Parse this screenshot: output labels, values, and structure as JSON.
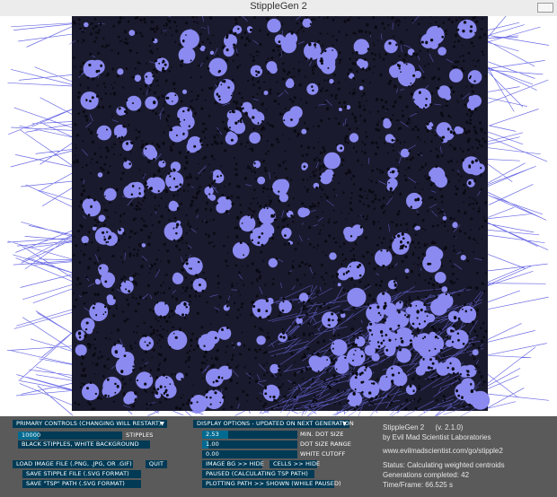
{
  "window": {
    "title": "StippleGen 2"
  },
  "primary": {
    "dropdown_label": "PRIMARY CONTROLS (CHANGING WILL RESTART)",
    "stipples_value": "10000",
    "stipples_fraction": 0.2,
    "stipples_label": "STIPPLES",
    "bg_button": "BLACK STIPPLES, WHITE BACKGROUND",
    "load_button": "LOAD IMAGE FILE (.PNG, .JPG, OR .GIF)",
    "quit_button": "QUIT",
    "save_svg_button": "SAVE STIPPLE FILE (.SVG FORMAT)",
    "save_tsp_button": "SAVE \"TSP\" PATH (.SVG FORMAT)"
  },
  "display": {
    "dropdown_label": "DISPLAY OPTIONS - UPDATED ON NEXT GENERATION",
    "min_dot_value": "2.53",
    "min_dot_fraction": 0.27,
    "min_dot_label": "MIN. DOT SIZE",
    "range_value": "1.00",
    "range_fraction": 0.07,
    "range_label": "DOT SIZE RANGE",
    "cutoff_value": "0.00",
    "cutoff_fraction": 0.0,
    "cutoff_label": "WHITE CUTOFF",
    "image_bg_button": "IMAGE BG >> HIDE",
    "cells_button": "CELLS >> HIDE",
    "paused_button": "PAUSED (CALCULATING TSP PATH)",
    "plotting_button": "PLOTTING PATH >> SHOWN (WHILE PAUSED)"
  },
  "info": {
    "app_name": "StippleGen 2",
    "version": "(v. 2.1.0)",
    "author": "by Evil Mad Scientist Laboratories",
    "url": "www.evilmadscientist.com/go/stipple2",
    "status": "Status: Calculating weighted centroids",
    "generations": "Generations completed: 42",
    "time_frame": "Time/Frame: 66.525 s"
  },
  "colors": {
    "stipple_dot": "#0a0a14",
    "cell_fill": "#8a8af0",
    "path_line": "#6c6ce6",
    "panel_bg": "#5a5a5a",
    "control_bg": "#003a55",
    "control_fill": "#006a90"
  }
}
